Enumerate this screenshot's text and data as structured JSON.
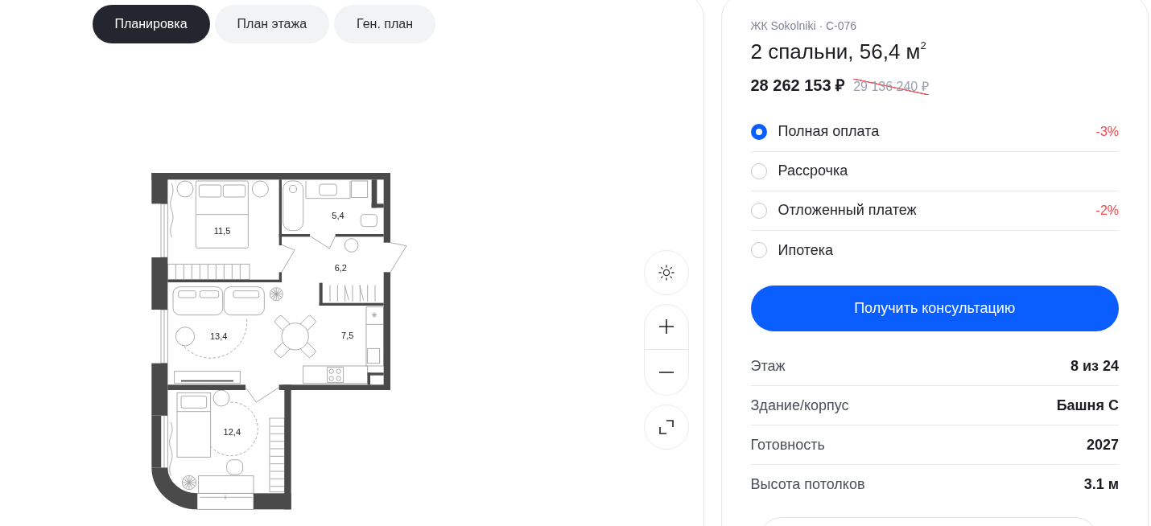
{
  "tabs": [
    {
      "label": "Планировка",
      "selected": true
    },
    {
      "label": "План этажа",
      "selected": false
    },
    {
      "label": "Ген. план",
      "selected": false
    }
  ],
  "floor_plan": {
    "rooms": [
      {
        "area": "11,5"
      },
      {
        "area": "5,4"
      },
      {
        "area": "6,2"
      },
      {
        "area": "13,4"
      },
      {
        "area": "7,5"
      },
      {
        "area": "12,4"
      }
    ]
  },
  "listing": {
    "subtitle": "ЖК Sokolniki · C-076",
    "title": "2 спальни, 56,4 м$^{2}$",
    "price": "28 262 153 ₽",
    "old_price": "29 136 240 ₽"
  },
  "payment_options": [
    {
      "label": "Полная оплата",
      "selected": true,
      "discount": "-3%"
    },
    {
      "label": "Рассрочка",
      "selected": false
    },
    {
      "label": "Отложенный платеж",
      "selected": false,
      "discount": "-2%"
    },
    {
      "label": "Ипотека",
      "selected": false
    }
  ],
  "cta_button": "Получить консультацию",
  "details": [
    {
      "label": "Этаж",
      "value": "8 из 24"
    },
    {
      "label": "Здание/корпус",
      "value": "Башня C"
    },
    {
      "label": "Готовность",
      "value": "2027"
    },
    {
      "label": "Высота потолков",
      "value": "3.1 м"
    }
  ]
}
